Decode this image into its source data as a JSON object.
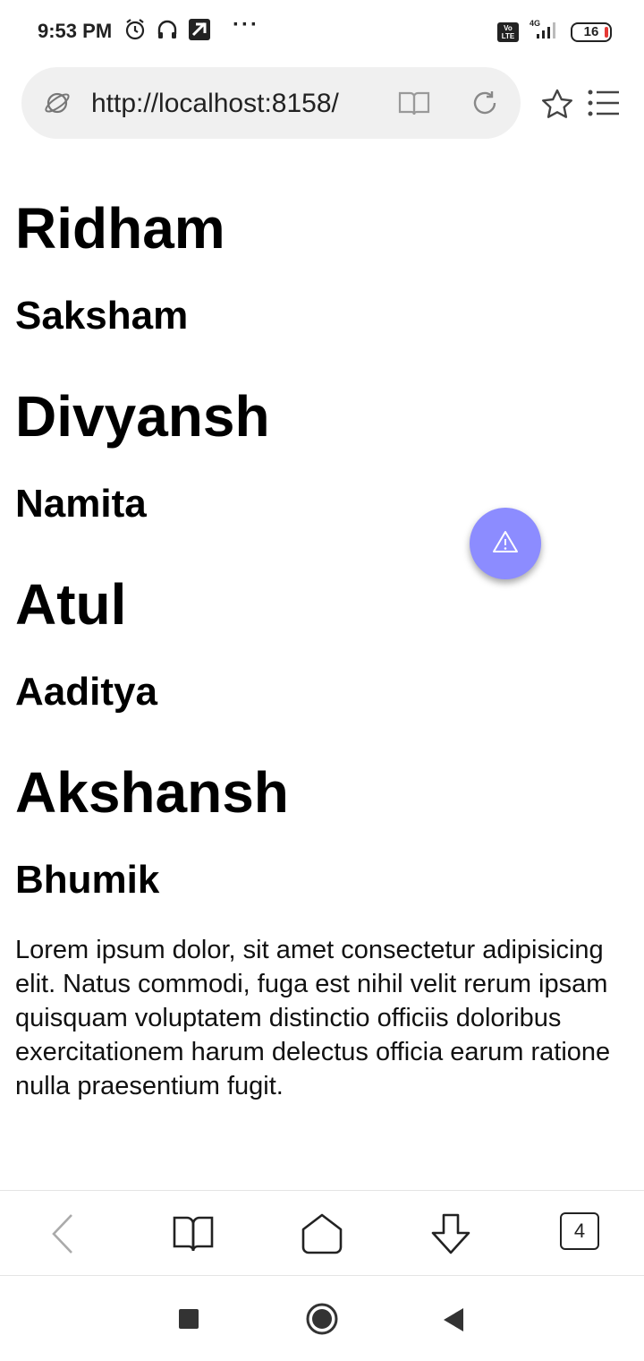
{
  "status_bar": {
    "time": "9:53 PM",
    "more": "···",
    "network": "4G",
    "volte": "Vo LTE",
    "battery": "16"
  },
  "browser": {
    "url": "http://localhost:8158/",
    "tabs_count": "4"
  },
  "page": {
    "headings": [
      {
        "text": "Ridham",
        "level": "h1"
      },
      {
        "text": "Saksham",
        "level": "h2"
      },
      {
        "text": "Divyansh",
        "level": "h1"
      },
      {
        "text": "Namita",
        "level": "h2"
      },
      {
        "text": "Atul",
        "level": "h1"
      },
      {
        "text": "Aaditya",
        "level": "h2"
      },
      {
        "text": "Akshansh",
        "level": "h1"
      },
      {
        "text": "Bhumik",
        "level": "h2"
      }
    ],
    "paragraph": "Lorem ipsum dolor, sit amet consectetur adipisicing elit. Natus commodi, fuga est nihil velit rerum ipsam quisquam voluptatem distinctio officiis doloribus exercitationem harum delectus officia earum ratione nulla praesentium fugit."
  },
  "colors": {
    "fab": "#8c8cff",
    "url_bar_bg": "#f0f0f0"
  },
  "icons": {
    "fab": "warning-icon",
    "url_left": "globe-icon",
    "reader": "book-icon",
    "reload": "reload-icon",
    "bookmark": "star-icon",
    "menu": "menu-list-icon"
  }
}
